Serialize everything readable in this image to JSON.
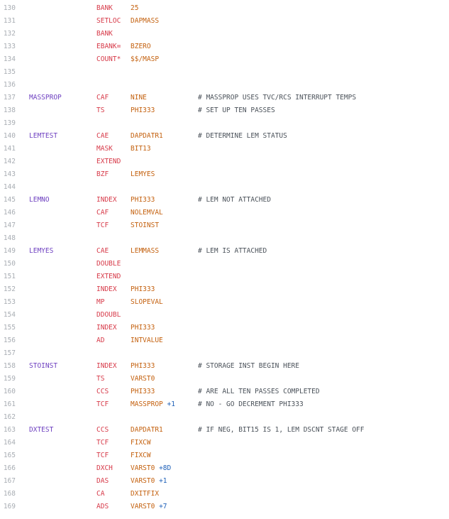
{
  "colors": {
    "background": "#ffffff",
    "line_number": "#a8adb3",
    "label": "#6f42c1",
    "opcode": "#d73a49",
    "operand": "#c4610f",
    "offset": "#1c5fb8",
    "comment": "#4b525a"
  },
  "lines": [
    {
      "n": "130",
      "label": "",
      "op": "BANK",
      "arg": "25",
      "off": "",
      "comment": ""
    },
    {
      "n": "131",
      "label": "",
      "op": "SETLOC",
      "arg": "DAPMASS",
      "off": "",
      "comment": ""
    },
    {
      "n": "132",
      "label": "",
      "op": "BANK",
      "arg": "",
      "off": "",
      "comment": ""
    },
    {
      "n": "133",
      "label": "",
      "op": "EBANK=",
      "arg": "BZERO",
      "off": "",
      "comment": ""
    },
    {
      "n": "134",
      "label": "",
      "op": "COUNT*",
      "arg": "$$/MASP",
      "off": "",
      "comment": ""
    },
    {
      "n": "135",
      "label": "",
      "op": "",
      "arg": "",
      "off": "",
      "comment": ""
    },
    {
      "n": "136",
      "label": "",
      "op": "",
      "arg": "",
      "off": "",
      "comment": ""
    },
    {
      "n": "137",
      "label": "MASSPROP",
      "op": "CAF",
      "arg": "NINE",
      "off": "",
      "comment": "# MASSPROP USES TVC/RCS INTERRUPT TEMPS"
    },
    {
      "n": "138",
      "label": "",
      "op": "TS",
      "arg": "PHI333",
      "off": "",
      "comment": "# SET UP TEN PASSES"
    },
    {
      "n": "139",
      "label": "",
      "op": "",
      "arg": "",
      "off": "",
      "comment": ""
    },
    {
      "n": "140",
      "label": "LEMTEST",
      "op": "CAE",
      "arg": "DAPDATR1",
      "off": "",
      "comment": "# DETERMINE LEM STATUS"
    },
    {
      "n": "141",
      "label": "",
      "op": "MASK",
      "arg": "BIT13",
      "off": "",
      "comment": ""
    },
    {
      "n": "142",
      "label": "",
      "op": "EXTEND",
      "arg": "",
      "off": "",
      "comment": ""
    },
    {
      "n": "143",
      "label": "",
      "op": "BZF",
      "arg": "LEMYES",
      "off": "",
      "comment": ""
    },
    {
      "n": "144",
      "label": "",
      "op": "",
      "arg": "",
      "off": "",
      "comment": ""
    },
    {
      "n": "145",
      "label": "LEMNO",
      "op": "INDEX",
      "arg": "PHI333",
      "off": "",
      "comment": "# LEM NOT ATTACHED"
    },
    {
      "n": "146",
      "label": "",
      "op": "CAF",
      "arg": "NOLEMVAL",
      "off": "",
      "comment": ""
    },
    {
      "n": "147",
      "label": "",
      "op": "TCF",
      "arg": "STOINST",
      "off": "",
      "comment": ""
    },
    {
      "n": "148",
      "label": "",
      "op": "",
      "arg": "",
      "off": "",
      "comment": ""
    },
    {
      "n": "149",
      "label": "LEMYES",
      "op": "CAE",
      "arg": "LEMMASS",
      "off": "",
      "comment": "# LEM IS ATTACHED"
    },
    {
      "n": "150",
      "label": "",
      "op": "DOUBLE",
      "arg": "",
      "off": "",
      "comment": ""
    },
    {
      "n": "151",
      "label": "",
      "op": "EXTEND",
      "arg": "",
      "off": "",
      "comment": ""
    },
    {
      "n": "152",
      "label": "",
      "op": "INDEX",
      "arg": "PHI333",
      "off": "",
      "comment": ""
    },
    {
      "n": "153",
      "label": "",
      "op": "MP",
      "arg": "SLOPEVAL",
      "off": "",
      "comment": ""
    },
    {
      "n": "154",
      "label": "",
      "op": "DDOUBL",
      "arg": "",
      "off": "",
      "comment": ""
    },
    {
      "n": "155",
      "label": "",
      "op": "INDEX",
      "arg": "PHI333",
      "off": "",
      "comment": ""
    },
    {
      "n": "156",
      "label": "",
      "op": "AD",
      "arg": "INTVALUE",
      "off": "",
      "comment": ""
    },
    {
      "n": "157",
      "label": "",
      "op": "",
      "arg": "",
      "off": "",
      "comment": ""
    },
    {
      "n": "158",
      "label": "STOINST",
      "op": "INDEX",
      "arg": "PHI333",
      "off": "",
      "comment": "# STORAGE INST BEGIN HERE"
    },
    {
      "n": "159",
      "label": "",
      "op": "TS",
      "arg": "VARST0",
      "off": "",
      "comment": ""
    },
    {
      "n": "160",
      "label": "",
      "op": "CCS",
      "arg": "PHI333",
      "off": "",
      "comment": "# ARE ALL TEN PASSES COMPLETED"
    },
    {
      "n": "161",
      "label": "",
      "op": "TCF",
      "arg": "MASSPROP",
      "off": "+1",
      "comment": "# NO - GO DECREMENT PHI333"
    },
    {
      "n": "162",
      "label": "",
      "op": "",
      "arg": "",
      "off": "",
      "comment": ""
    },
    {
      "n": "163",
      "label": "DXTEST",
      "op": "CCS",
      "arg": "DAPDATR1",
      "off": "",
      "comment": "# IF NEG, BIT15 IS 1, LEM DSCNT STAGE OFF"
    },
    {
      "n": "164",
      "label": "",
      "op": "TCF",
      "arg": "FIXCW",
      "off": "",
      "comment": ""
    },
    {
      "n": "165",
      "label": "",
      "op": "TCF",
      "arg": "FIXCW",
      "off": "",
      "comment": ""
    },
    {
      "n": "166",
      "label": "",
      "op": "DXCH",
      "arg": "VARST0",
      "off": "+8D",
      "comment": ""
    },
    {
      "n": "167",
      "label": "",
      "op": "DAS",
      "arg": "VARST0",
      "off": "+1",
      "comment": ""
    },
    {
      "n": "168",
      "label": "",
      "op": "CA",
      "arg": "DXITFIX",
      "off": "",
      "comment": ""
    },
    {
      "n": "169",
      "label": "",
      "op": "ADS",
      "arg": "VARST0",
      "off": "+7",
      "comment": ""
    }
  ]
}
